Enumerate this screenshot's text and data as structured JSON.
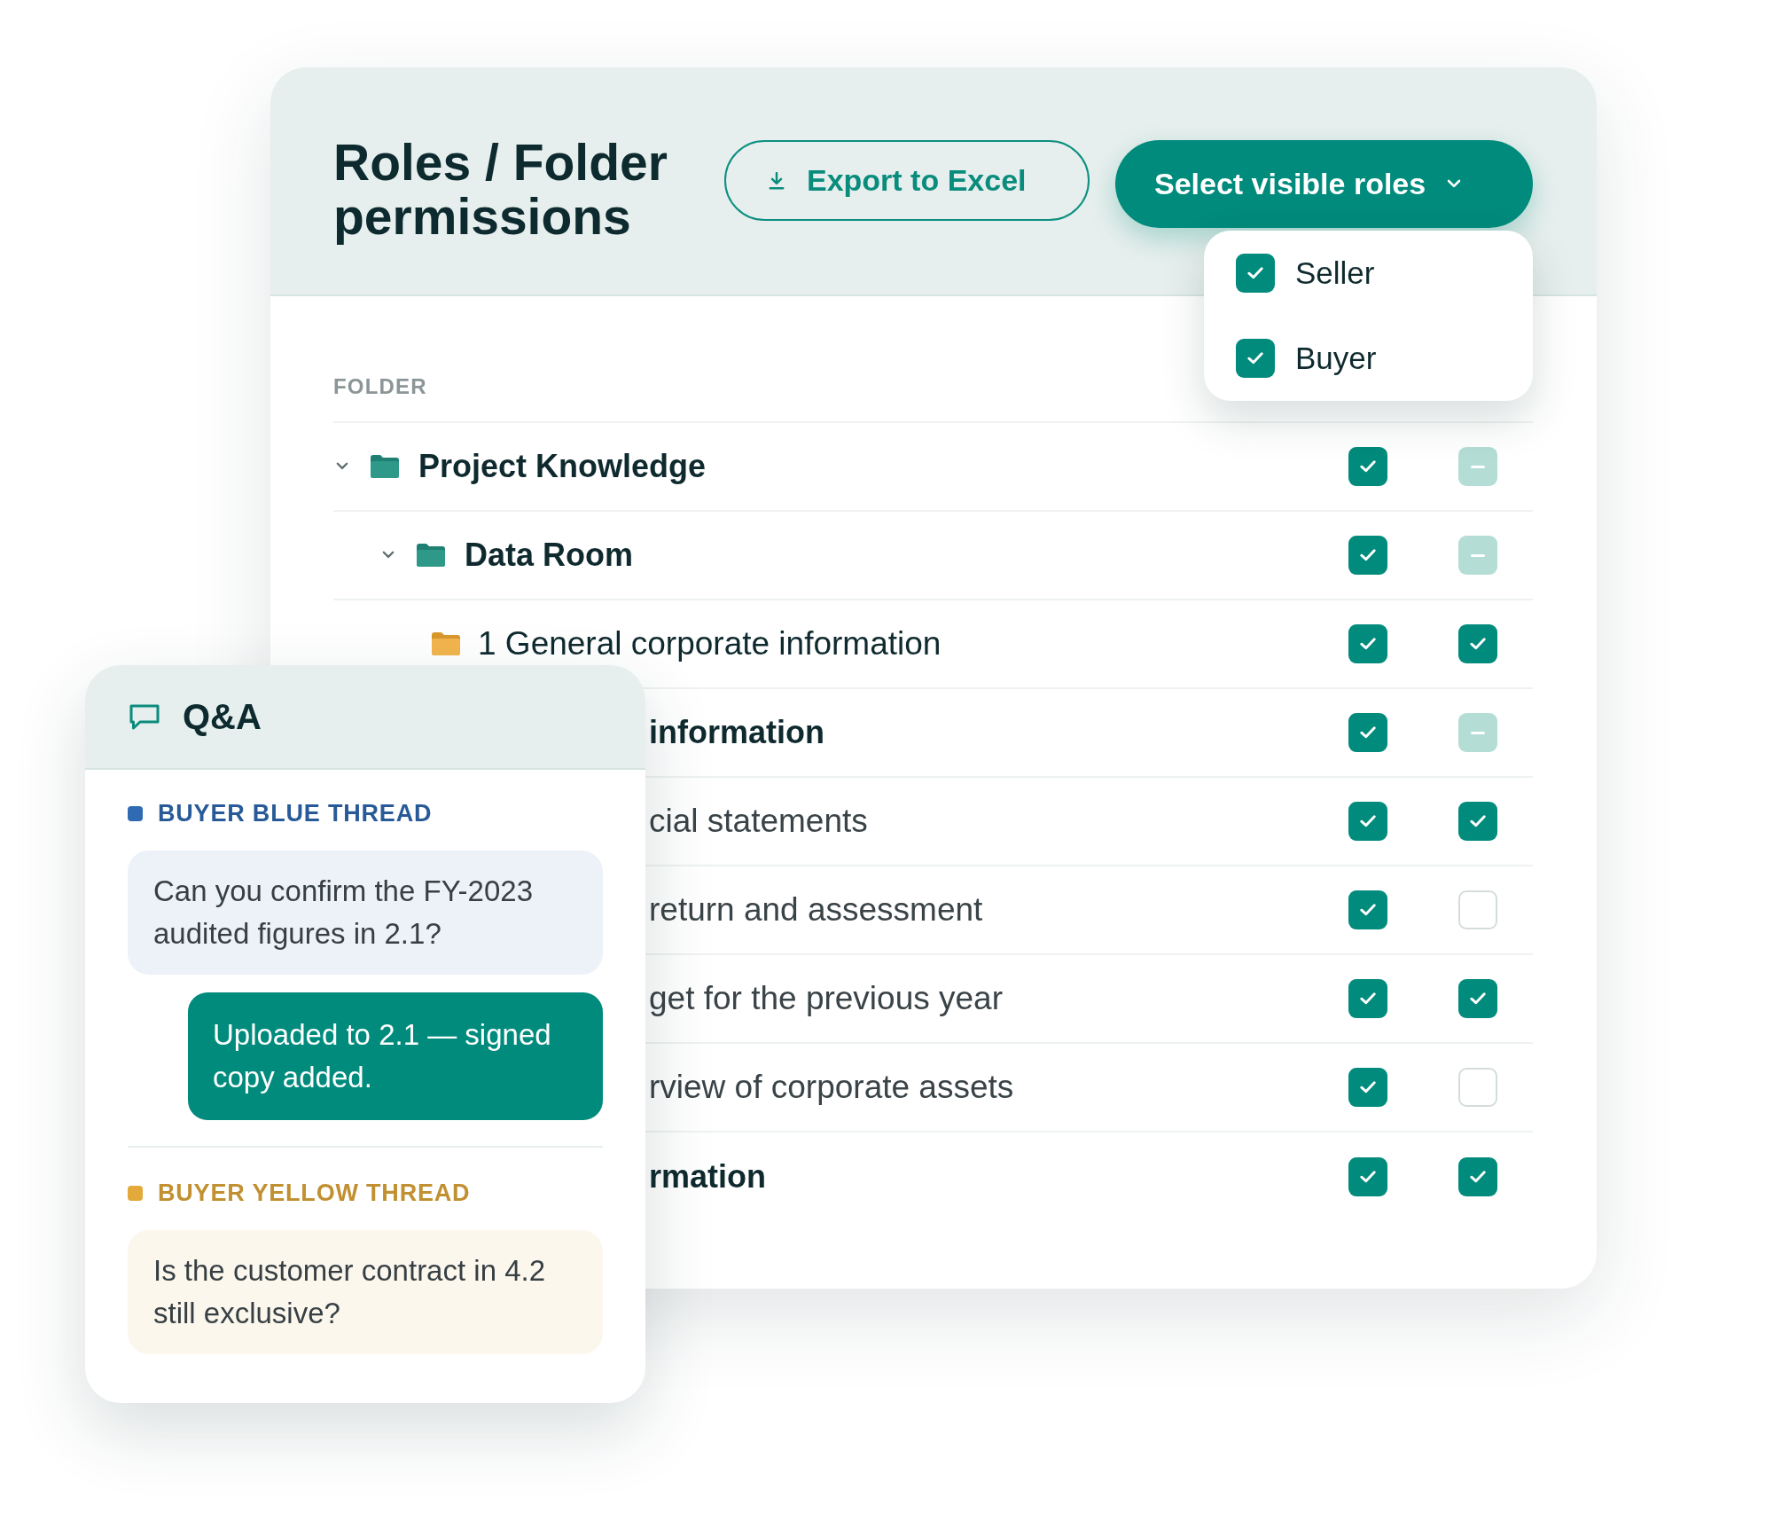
{
  "header": {
    "title": "Roles / Folder permissions",
    "export_button": {
      "label": "Export to Excel"
    },
    "roles_button": {
      "label": "Select visible roles"
    }
  },
  "roles_menu": [
    {
      "label": "Seller",
      "checked": true
    },
    {
      "label": "Buyer",
      "checked": true
    }
  ],
  "table": {
    "columns": [
      {
        "label": "FOLDER"
      }
    ],
    "rows": [
      {
        "label": "Project Knowledge",
        "kind": "folder",
        "expanded": true,
        "permissions": [
          {
            "checked": true,
            "indeterminate": false
          },
          {
            "checked": false,
            "indeterminate": true
          }
        ],
        "children": [
          {
            "label": "Data Room",
            "kind": "folder",
            "expanded": true,
            "permissions": [
              {
                "checked": true,
                "indeterminate": false
              },
              {
                "checked": false,
                "indeterminate": true
              }
            ],
            "children": [
              {
                "label": "1 General corporate information",
                "kind": "subfolder",
                "permissions": [
                  {
                    "checked": true,
                    "indeterminate": false
                  },
                  {
                    "checked": true,
                    "indeterminate": false
                  }
                ]
              },
              {
                "label": "information",
                "kind": "group",
                "permissions": [
                  {
                    "checked": true,
                    "indeterminate": false
                  },
                  {
                    "checked": false,
                    "indeterminate": true
                  }
                ],
                "children": [
                  {
                    "label": "cial statements",
                    "kind": "entry",
                    "permissions": [
                      {
                        "checked": true,
                        "indeterminate": false
                      },
                      {
                        "checked": true,
                        "indeterminate": false
                      }
                    ]
                  },
                  {
                    "label": "return and assessment",
                    "kind": "entry",
                    "permissions": [
                      {
                        "checked": true,
                        "indeterminate": false
                      },
                      {
                        "checked": false,
                        "indeterminate": false
                      }
                    ]
                  },
                  {
                    "label": "get for the previous year",
                    "kind": "entry",
                    "permissions": [
                      {
                        "checked": true,
                        "indeterminate": false
                      },
                      {
                        "checked": true,
                        "indeterminate": false
                      }
                    ]
                  },
                  {
                    "label": "rview of corporate assets",
                    "kind": "entry",
                    "permissions": [
                      {
                        "checked": true,
                        "indeterminate": false
                      },
                      {
                        "checked": false,
                        "indeterminate": false
                      }
                    ]
                  }
                ]
              },
              {
                "label": "rmation",
                "kind": "group",
                "permissions": [
                  {
                    "checked": true,
                    "indeterminate": false
                  },
                  {
                    "checked": true,
                    "indeterminate": false
                  }
                ]
              }
            ]
          }
        ]
      }
    ]
  },
  "qa_panel": {
    "title": "Q&A",
    "threads": [
      {
        "name": "BUYER BLUE THREAD",
        "color": "#2f6ab3",
        "messages": [
          {
            "kind": "question",
            "text": "Can you confirm the FY-2023 audited figures in 2.1?"
          },
          {
            "kind": "answer",
            "text": "Uploaded to 2.1 — signed copy added."
          }
        ]
      },
      {
        "name": "BUYER YELLOW THREAD",
        "color": "#e3a93a",
        "messages": [
          {
            "kind": "question",
            "text": "Is the customer contract in 4.2 still exclusive?"
          }
        ]
      }
    ]
  }
}
